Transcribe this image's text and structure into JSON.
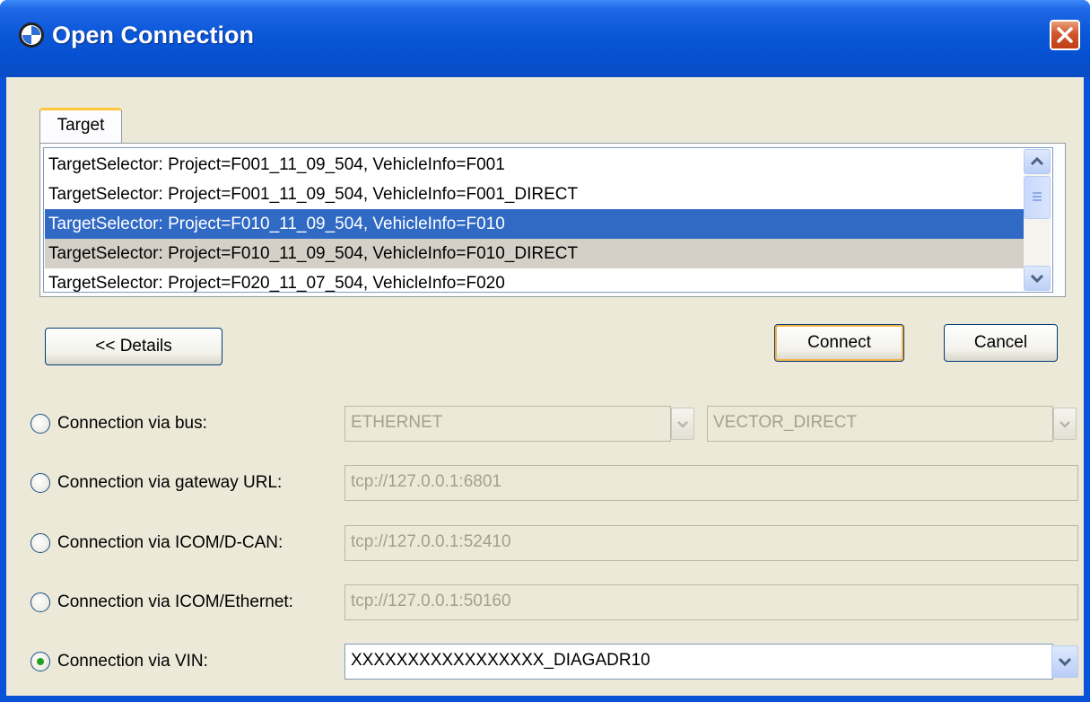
{
  "window": {
    "title": "Open Connection"
  },
  "tab": {
    "label": "Target"
  },
  "targets": [
    "TargetSelector: Project=F001_11_09_504, VehicleInfo=F001",
    "TargetSelector: Project=F001_11_09_504, VehicleInfo=F001_DIRECT",
    "TargetSelector: Project=F010_11_09_504, VehicleInfo=F010",
    "TargetSelector: Project=F010_11_09_504, VehicleInfo=F010_DIRECT",
    "TargetSelector: Project=F020_11_07_504, VehicleInfo=F020"
  ],
  "selected_target_index": 2,
  "buttons": {
    "details": "<< Details",
    "connect": "Connect",
    "cancel": "Cancel"
  },
  "connections": {
    "bus": {
      "label": "Connection via bus:",
      "value1": "ETHERNET",
      "value2": "VECTOR_DIRECT"
    },
    "gateway": {
      "label": "Connection via gateway URL:",
      "value": "tcp://127.0.0.1:6801"
    },
    "icom_dcan": {
      "label": "Connection via ICOM/D-CAN:",
      "value": "tcp://127.0.0.1:52410"
    },
    "icom_eth": {
      "label": "Connection via ICOM/Ethernet:",
      "value": "tcp://127.0.0.1:50160"
    },
    "vin": {
      "label": "Connection via VIN:",
      "value": "XXXXXXXXXXXXXXXXX_DIAGADR10"
    }
  },
  "selected_connection": "vin",
  "icons": {
    "app": "bmw-logo-icon",
    "close": "close-icon"
  }
}
